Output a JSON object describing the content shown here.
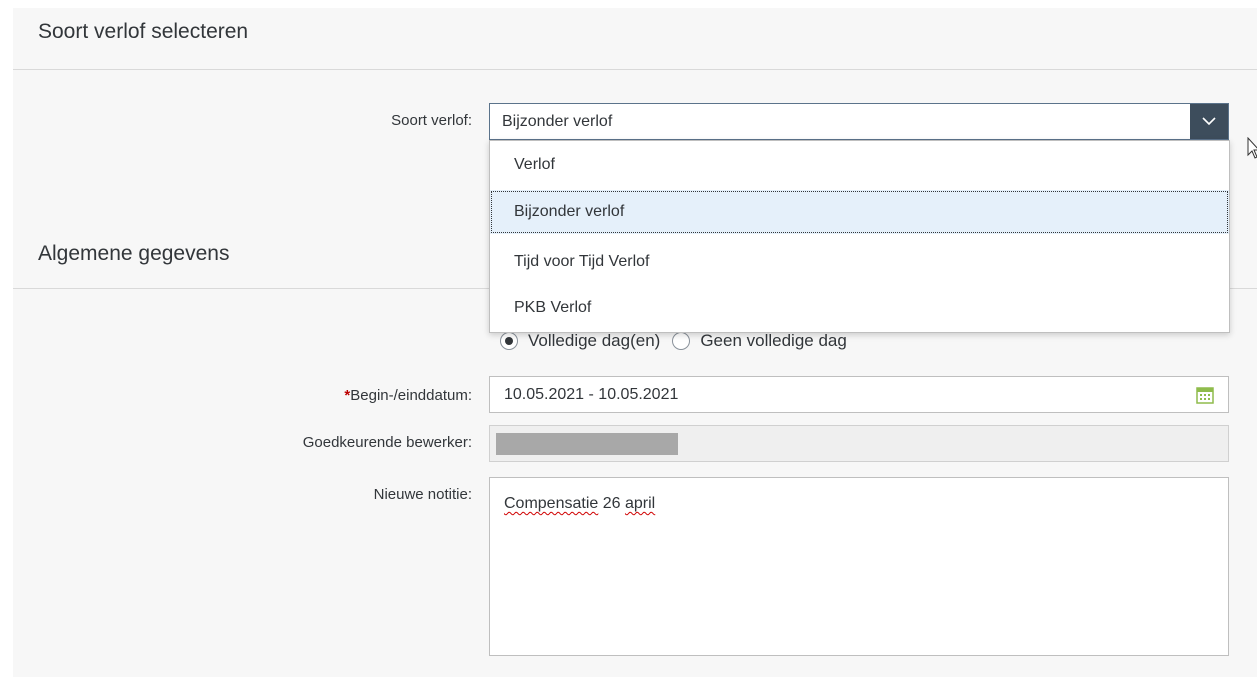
{
  "section_leave_type": {
    "title": "Soort verlof selecteren",
    "label": "Soort verlof:",
    "selected_value": "Bijzonder verlof",
    "options": [
      "Verlof",
      "Bijzonder verlof",
      "Tijd voor Tijd Verlof",
      "PKB Verlof"
    ],
    "highlighted_option": "Bijzonder verlof"
  },
  "section_general": {
    "title": "Algemene gegevens",
    "duration": {
      "option_full": "Volledige dag(en)",
      "option_partial": "Geen volledige dag",
      "selected": "Volledige dag(en)"
    },
    "date_label_required_mark": "*",
    "date_label": "Begin-/einddatum:",
    "date_value": "10.05.2021 - 10.05.2021",
    "approver_label": "Goedkeurende bewerker:",
    "note_label": "Nieuwe notitie:",
    "note_words": [
      "Compensatie",
      "26",
      "april"
    ]
  },
  "icons": {
    "dropdown_arrow": "chevron-down-icon",
    "calendar": "calendar-icon",
    "cursor": "mouse-pointer-icon"
  },
  "colors": {
    "required": "#bb0000",
    "dropdown_button": "#3d4d5c",
    "selected_option_bg": "#e5f0fa",
    "calendar_icon": "#8fbc4c"
  }
}
